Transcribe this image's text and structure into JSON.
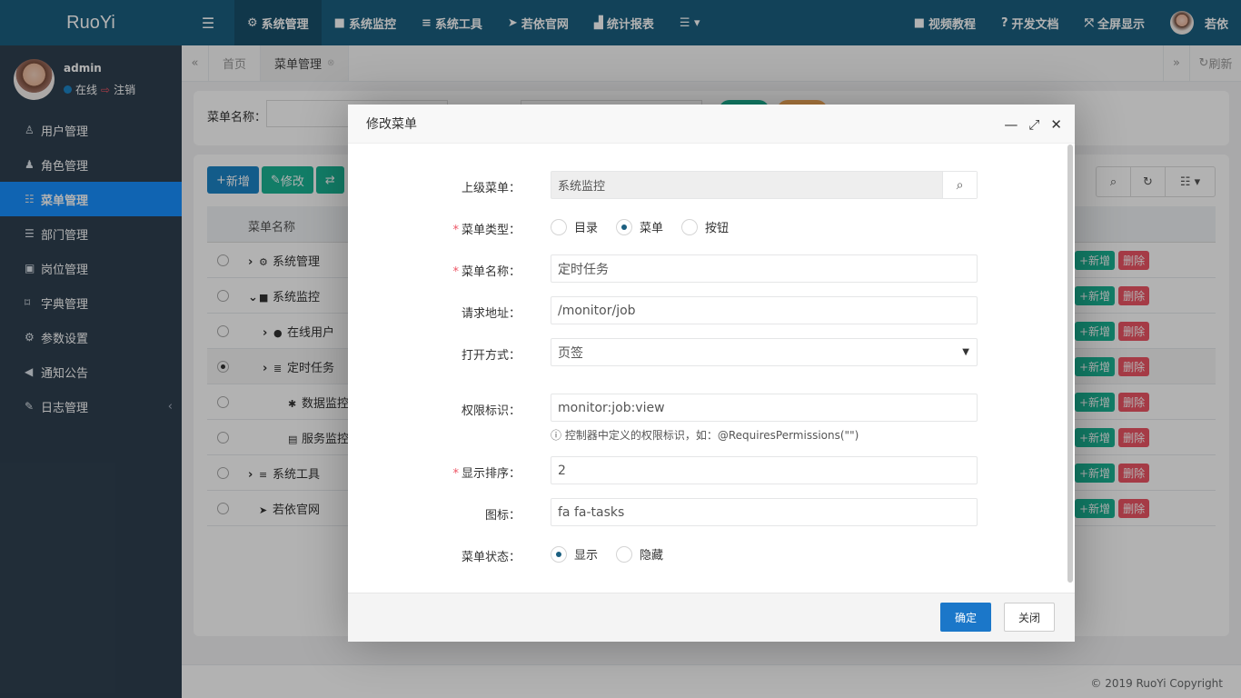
{
  "app": {
    "logo": "RuoYi"
  },
  "user": {
    "name": "admin",
    "status": "在线",
    "logout": "注销"
  },
  "sidebar": {
    "items": [
      {
        "label": "用户管理",
        "icon": "user-icon"
      },
      {
        "label": "角色管理",
        "icon": "role-icon"
      },
      {
        "label": "菜单管理",
        "icon": "menu-icon",
        "active": true
      },
      {
        "label": "部门管理",
        "icon": "dept-icon"
      },
      {
        "label": "岗位管理",
        "icon": "post-icon"
      },
      {
        "label": "字典管理",
        "icon": "bookmark-icon"
      },
      {
        "label": "参数设置",
        "icon": "gear-icon"
      },
      {
        "label": "通知公告",
        "icon": "bullhorn-icon"
      },
      {
        "label": "日志管理",
        "icon": "edit-icon",
        "has_arrow": true
      }
    ]
  },
  "topnav": {
    "items": [
      "系统管理",
      "系统监控",
      "系统工具",
      "若依官网",
      "统计报表"
    ],
    "right": [
      "视频教程",
      "开发文档",
      "全屏显示"
    ],
    "user": "若依"
  },
  "tabs": {
    "home": "首页",
    "current": "菜单管理",
    "refresh": "刷新"
  },
  "search": {
    "label": "菜单名称："
  },
  "toolbar": {
    "add": "新增",
    "edit": "修改"
  },
  "table": {
    "header": "菜单名称",
    "rows": [
      {
        "name": "系统管理",
        "indent": 0,
        "expander": "›",
        "icon": "⚙"
      },
      {
        "name": "系统监控",
        "indent": 0,
        "expander": "⌄",
        "icon": "■"
      },
      {
        "name": "在线用户",
        "indent": 1,
        "expander": "›",
        "icon": "●"
      },
      {
        "name": "定时任务",
        "indent": 1,
        "expander": "›",
        "icon": "≣",
        "selected": true
      },
      {
        "name": "数据监控",
        "indent": 2,
        "expander": "",
        "icon": "✱"
      },
      {
        "name": "服务监控",
        "indent": 2,
        "expander": "",
        "icon": "▤"
      },
      {
        "name": "系统工具",
        "indent": 0,
        "expander": "›",
        "icon": "≡"
      },
      {
        "name": "若依官网",
        "indent": 0,
        "expander": "",
        "icon": "➤"
      }
    ],
    "op_add": "+新增",
    "op_del": "删除"
  },
  "modal": {
    "title": "修改菜单",
    "parent": {
      "label": "上级菜单：",
      "value": "系统监控"
    },
    "type": {
      "label": "菜单类型：",
      "options": [
        "目录",
        "菜单",
        "按钮"
      ],
      "selected": "菜单"
    },
    "name": {
      "label": "菜单名称：",
      "value": "定时任务"
    },
    "url": {
      "label": "请求地址：",
      "value": "/monitor/job"
    },
    "target": {
      "label": "打开方式：",
      "value": "页签"
    },
    "perms": {
      "label": "权限标识：",
      "value": "monitor:job:view",
      "help": "控制器中定义的权限标识，如：@RequiresPermissions(\"\")"
    },
    "order": {
      "label": "显示排序：",
      "value": "2"
    },
    "icon": {
      "label": "图标：",
      "value": "fa fa-tasks"
    },
    "visible": {
      "label": "菜单状态：",
      "options": [
        "显示",
        "隐藏"
      ],
      "selected": "显示"
    },
    "ok": "确定",
    "close": "关闭"
  },
  "footer": {
    "copyright": "© 2019 RuoYi Copyright"
  }
}
